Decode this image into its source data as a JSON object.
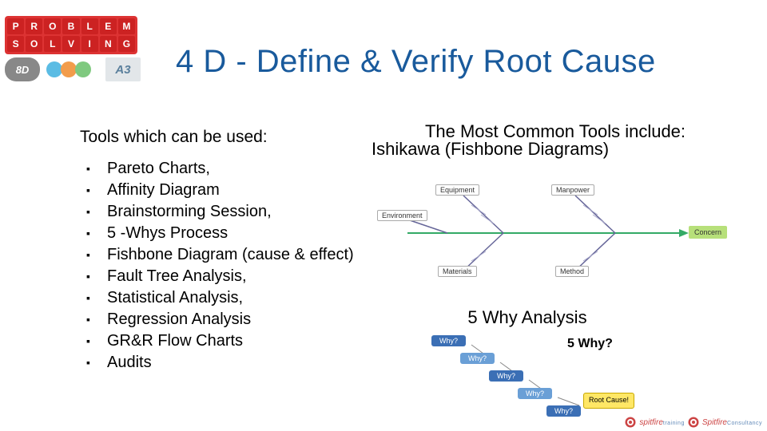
{
  "header": {
    "logo_letters": [
      "P",
      "R",
      "O",
      "B",
      "L",
      "E",
      "M",
      "S",
      "O",
      "L",
      "V",
      "I",
      "N",
      "G"
    ],
    "badge_8d": "8D",
    "badge_a3": "A3"
  },
  "title": "4 D - Define & Verify Root Cause",
  "left": {
    "lead": "Tools which can be used:",
    "items": [
      "Pareto Charts,",
      "Affinity Diagram",
      "Brainstorming Session,",
      "5 -Whys Process",
      "Fishbone Diagram (cause & effect)",
      "Fault Tree Analysis,",
      "Statistical Analysis,",
      "Regression Analysis",
      "GR&R Flow Charts",
      "Audits"
    ]
  },
  "right": {
    "common_title": "The Most Common Tools include:",
    "ishikawa": "Ishikawa (Fishbone Diagrams)",
    "fishbone_labels": {
      "equipment": "Equipment",
      "manpower": "Manpower",
      "environment": "Environment",
      "materials": "Materials",
      "method": "Method",
      "concern": "Concern"
    },
    "five_why_title": "5 Why Analysis",
    "five_why_logo": "5 Why?",
    "why_label": "Why?",
    "root_cause": "Root Cause!"
  },
  "footer": {
    "brand": "spitfire",
    "tag1": "training",
    "brand2": "Spitfire",
    "tag2": "Consultancy"
  }
}
